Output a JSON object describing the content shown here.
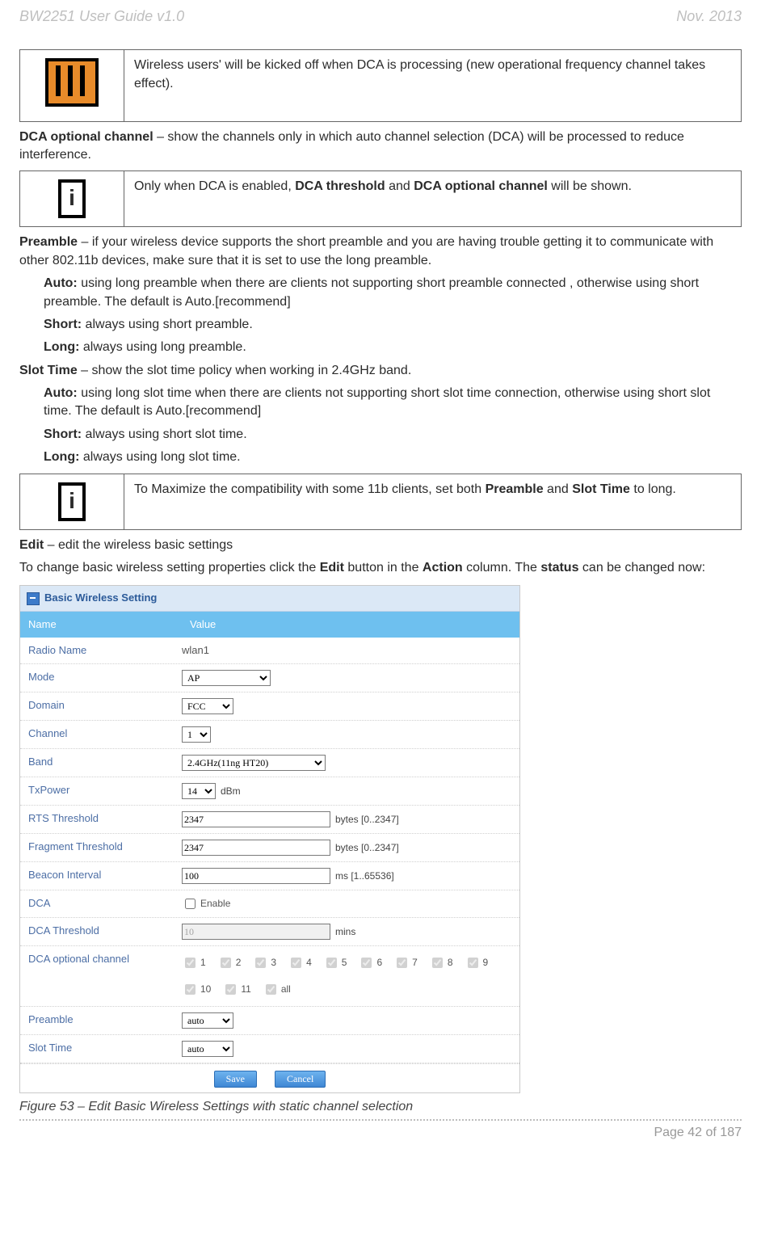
{
  "header": {
    "left": "BW2251 User Guide v1.0",
    "right": "Nov.  2013"
  },
  "note1": "Wireless users' will be kicked off when DCA is processing (new operational frequency channel takes effect).",
  "dca_optional": {
    "term": "DCA optional channel",
    "desc": " – show the channels only in which auto channel selection (DCA) will be processed to reduce interference."
  },
  "note2": {
    "pre": "Only when DCA is enabled, ",
    "b1": "DCA threshold",
    "mid": " and ",
    "b2": "DCA optional channel",
    "post": " will be shown."
  },
  "preamble": {
    "term": "Preamble",
    "desc": " – if your wireless device supports the short preamble and you are having trouble getting it to communicate with other 802.11b devices, make sure that it is set to use the long preamble.",
    "auto": {
      "b": "Auto:",
      "t": " using long preamble when there are clients not supporting short preamble connected , otherwise using short preamble. The default is Auto.[recommend]"
    },
    "short": {
      "b": "Short:",
      "t": " always using short preamble."
    },
    "long": {
      "b": "Long:",
      "t": " always using long preamble."
    }
  },
  "slot": {
    "term": "Slot Time",
    "desc": " – show the slot time policy when working in 2.4GHz band.",
    "auto": {
      "b": "Auto:",
      "t": " using long slot time when there are clients not supporting short slot time connection, otherwise using short slot time. The default is Auto.[recommend]"
    },
    "short": {
      "b": "Short:",
      "t": " always using short slot time."
    },
    "long": {
      "b": "Long:",
      "t": " always using long slot time."
    }
  },
  "note3": {
    "pre": "To Maximize the compatibility with some 11b clients, set both ",
    "b1": "Preamble",
    "mid": " and ",
    "b2": "Slot Time",
    "post": " to long."
  },
  "edit": {
    "term": "Edit",
    "desc": " – edit the wireless basic settings"
  },
  "change": {
    "pre": "To change basic wireless setting properties click the ",
    "b1": "Edit",
    "mid": " button in the ",
    "b2": "Action",
    "mid2": " column. The ",
    "b3": "status",
    "post": " can be changed now:"
  },
  "figure": {
    "title": "Basic Wireless Setting",
    "col1": "Name",
    "col2": "Value",
    "rows": {
      "radio": {
        "lbl": "Radio Name",
        "val": "wlan1"
      },
      "mode": {
        "lbl": "Mode",
        "val": "AP"
      },
      "domain": {
        "lbl": "Domain",
        "val": "FCC"
      },
      "channel": {
        "lbl": "Channel",
        "val": "1"
      },
      "band": {
        "lbl": "Band",
        "val": "2.4GHz(11ng HT20)"
      },
      "tx": {
        "lbl": "TxPower",
        "val": "14",
        "unit": "dBm"
      },
      "rts": {
        "lbl": "RTS Threshold",
        "val": "2347",
        "unit": "bytes [0..2347]"
      },
      "frag": {
        "lbl": "Fragment Threshold",
        "val": "2347",
        "unit": "bytes [0..2347]"
      },
      "beacon": {
        "lbl": "Beacon Interval",
        "val": "100",
        "unit": "ms [1..65536]"
      },
      "dca": {
        "lbl": "DCA",
        "unit": "Enable"
      },
      "dcath": {
        "lbl": "DCA Threshold",
        "val": "10",
        "unit": "mins"
      },
      "dcaopt": {
        "lbl": "DCA optional channel",
        "opts": [
          "1",
          "2",
          "3",
          "4",
          "5",
          "6",
          "7",
          "8",
          "9",
          "10",
          "11",
          "all"
        ]
      },
      "preamble": {
        "lbl": "Preamble",
        "val": "auto"
      },
      "slot": {
        "lbl": "Slot Time",
        "val": "auto"
      }
    },
    "save": "Save",
    "cancel": "Cancel"
  },
  "caption": "Figure 53 – Edit Basic Wireless Settings with static channel selection",
  "footer": "Page 42 of 187"
}
